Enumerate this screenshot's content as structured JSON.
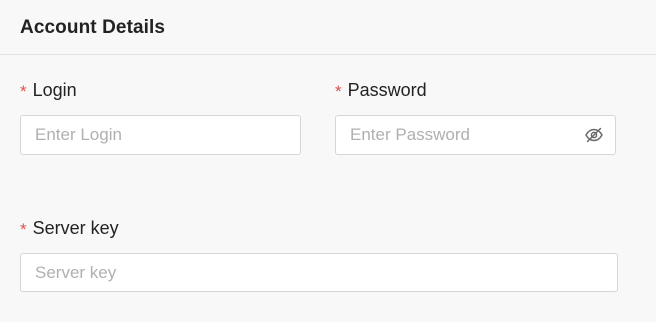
{
  "section": {
    "title": "Account Details"
  },
  "fields": {
    "login": {
      "required_mark": "*",
      "label": "Login",
      "placeholder": "Enter Login",
      "value": ""
    },
    "password": {
      "required_mark": "*",
      "label": "Password",
      "placeholder": "Enter Password",
      "value": "",
      "toggle_icon": "eye-slash-icon"
    },
    "server_key": {
      "required_mark": "*",
      "label": "Server key",
      "placeholder": "Server key",
      "value": ""
    }
  },
  "colors": {
    "required": "#e05050",
    "placeholder": "#b0b0b0",
    "border": "#d6d6d6",
    "background": "#f8f8f8"
  }
}
